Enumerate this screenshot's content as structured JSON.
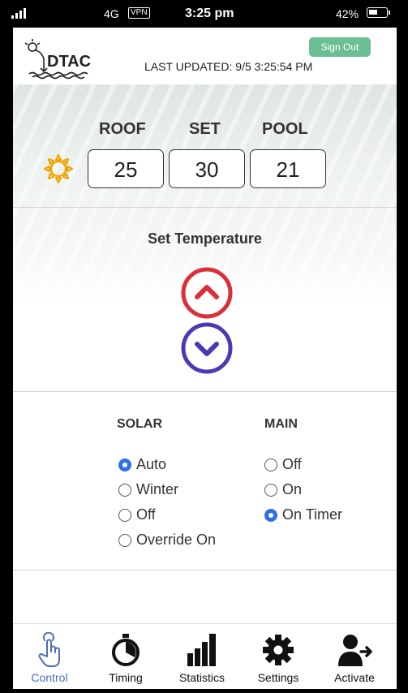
{
  "status_bar": {
    "network": "4G",
    "vpn": "VPN",
    "time": "3:25 pm",
    "battery": "42%"
  },
  "header": {
    "logo_text": "DTAC",
    "sign_out_label": "Sign Out",
    "last_updated": "LAST UPDATED: 9/5 3:25:54 PM"
  },
  "temps": {
    "roof_label": "ROOF",
    "set_label": "SET",
    "pool_label": "POOL",
    "roof_value": "25",
    "set_value": "30",
    "pool_value": "21"
  },
  "set_temperature": {
    "title": "Set Temperature",
    "up_color": "#d9303a",
    "down_color": "#4a3bb5"
  },
  "solar": {
    "title": "SOLAR",
    "options": [
      "Auto",
      "Winter",
      "Off",
      "Override On"
    ],
    "selected": "Auto"
  },
  "main": {
    "title": "MAIN",
    "options": [
      "Off",
      "On",
      "On Timer"
    ],
    "selected": "On Timer"
  },
  "tabs": [
    {
      "label": "Control",
      "icon": "touch-icon",
      "active": true
    },
    {
      "label": "Timing",
      "icon": "stopwatch-icon",
      "active": false
    },
    {
      "label": "Statistics",
      "icon": "bar-chart-icon",
      "active": false
    },
    {
      "label": "Settings",
      "icon": "gear-icon",
      "active": false
    },
    {
      "label": "Activate",
      "icon": "add-user-icon",
      "active": false
    }
  ],
  "colors": {
    "accent_blue": "#2f6fe8",
    "sign_out_green": "#6cbf92",
    "active_tab": "#4a6fb4",
    "sun_orange": "#f0a500"
  }
}
